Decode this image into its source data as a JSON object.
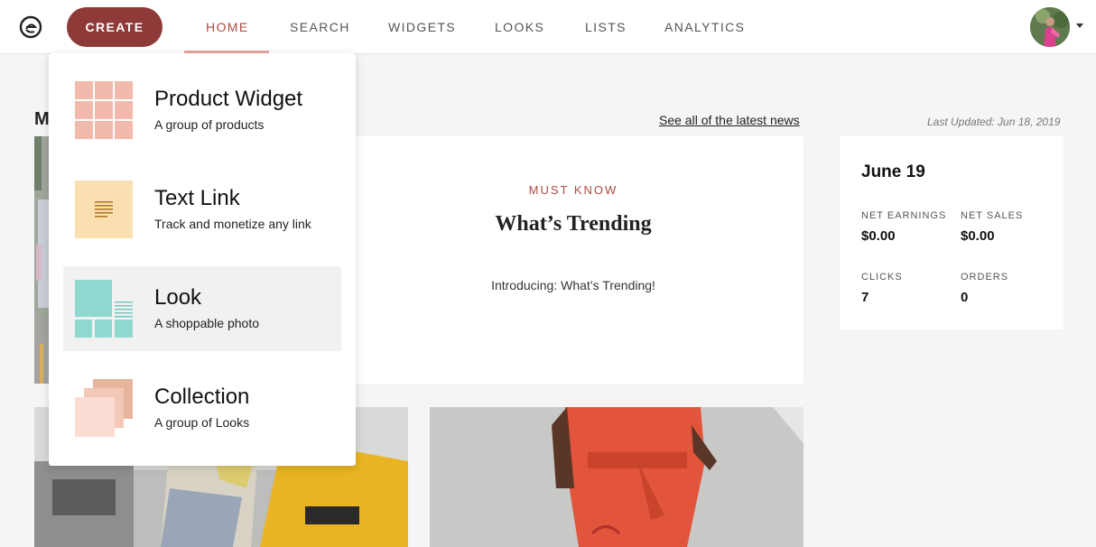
{
  "header": {
    "logo_icon": "collective-voice-logo-icon",
    "create_label": "CREATE",
    "nav": [
      {
        "label": "HOME",
        "active": true
      },
      {
        "label": "SEARCH",
        "active": false
      },
      {
        "label": "WIDGETS",
        "active": false
      },
      {
        "label": "LOOKS",
        "active": false
      },
      {
        "label": "LISTS",
        "active": false
      },
      {
        "label": "ANALYTICS",
        "active": false
      }
    ],
    "accent_color": "#8e3a38"
  },
  "main": {
    "section_title": "M",
    "see_all_link": "See all of the latest news",
    "news": {
      "eyebrow": "MUST KNOW",
      "title": "What’s Trending",
      "description": "Introducing: What’s Trending!"
    }
  },
  "stats": {
    "last_updated": "Last Updated: Jun 18, 2019",
    "date": "June 19",
    "items": [
      {
        "label": "NET EARNINGS",
        "value": "$0.00"
      },
      {
        "label": "NET SALES",
        "value": "$0.00"
      },
      {
        "label": "CLICKS",
        "value": "7"
      },
      {
        "label": "ORDERS",
        "value": "0"
      }
    ]
  },
  "create_menu": {
    "items": [
      {
        "title": "Product Widget",
        "subtitle": "A group of products",
        "icon": "product-grid-icon",
        "color": "#f2b9ad"
      },
      {
        "title": "Text Link",
        "subtitle": "Track and monetize any link",
        "icon": "text-lines-icon",
        "color": "#fae0b0"
      },
      {
        "title": "Look",
        "subtitle": "A shoppable photo",
        "icon": "look-photo-icon",
        "color": "#8fd8d0"
      },
      {
        "title": "Collection",
        "subtitle": "A group of Looks",
        "icon": "stacked-cards-icon",
        "color": "#f4c4b0"
      }
    ]
  }
}
